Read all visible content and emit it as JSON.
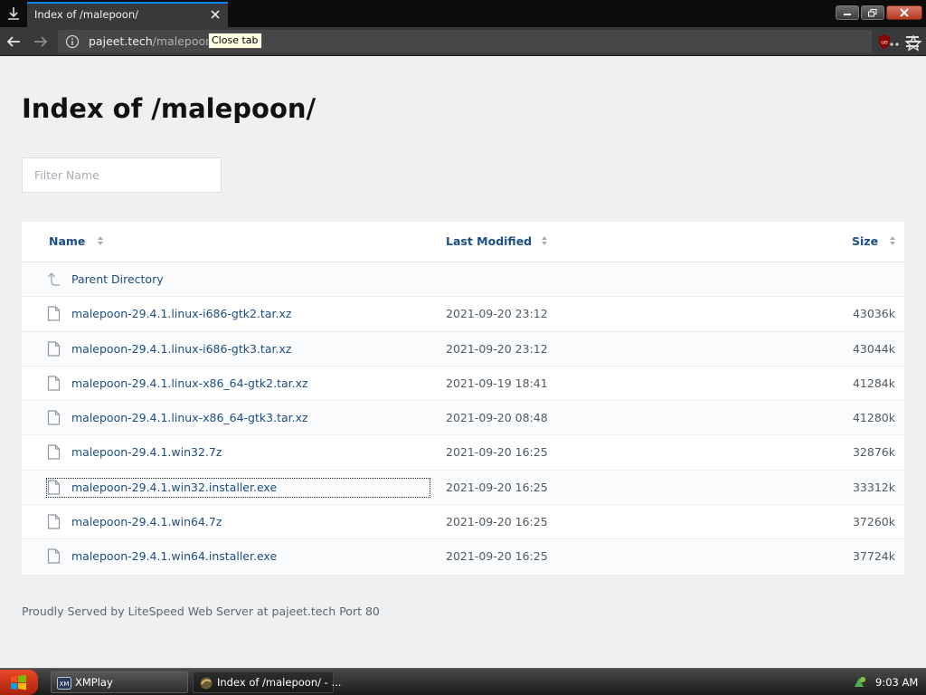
{
  "browser": {
    "tab_title": "Index of /malepoon/",
    "url_domain": "pajeet.tech",
    "url_path": "/malepoon/",
    "tooltip": "Close tab"
  },
  "page": {
    "title": "Index of /malepoon/",
    "filter_placeholder": "Filter Name",
    "columns": {
      "name": "Name",
      "modified": "Last Modified",
      "size": "Size"
    },
    "parent_label": "Parent Directory",
    "files": [
      {
        "name": "malepoon-29.4.1.linux-i686-gtk2.tar.xz",
        "modified": "2021-09-20 23:12",
        "size": "43036k"
      },
      {
        "name": "malepoon-29.4.1.linux-i686-gtk3.tar.xz",
        "modified": "2021-09-20 23:12",
        "size": "43044k"
      },
      {
        "name": "malepoon-29.4.1.linux-x86_64-gtk2.tar.xz",
        "modified": "2021-09-19 18:41",
        "size": "41284k"
      },
      {
        "name": "malepoon-29.4.1.linux-x86_64-gtk3.tar.xz",
        "modified": "2021-09-20 08:48",
        "size": "41280k"
      },
      {
        "name": "malepoon-29.4.1.win32.7z",
        "modified": "2021-09-20 16:25",
        "size": "32876k"
      },
      {
        "name": "malepoon-29.4.1.win32.installer.exe",
        "modified": "2021-09-20 16:25",
        "size": "33312k"
      },
      {
        "name": "malepoon-29.4.1.win64.7z",
        "modified": "2021-09-20 16:25",
        "size": "37260k"
      },
      {
        "name": "malepoon-29.4.1.win64.installer.exe",
        "modified": "2021-09-20 16:25",
        "size": "37724k"
      }
    ],
    "footer": "Proudly Served by LiteSpeed Web Server at pajeet.tech Port 80"
  },
  "taskbar": {
    "tasks": [
      {
        "label": "XMPlay",
        "icon": "xmplay-icon"
      },
      {
        "label": "Index of /malepoon/ - ...",
        "icon": "browser-icon"
      }
    ],
    "clock": "9:03 AM"
  },
  "colors": {
    "link": "#1e4c80",
    "accent": "#0a84ff",
    "page_bg": "#eef0f2"
  }
}
